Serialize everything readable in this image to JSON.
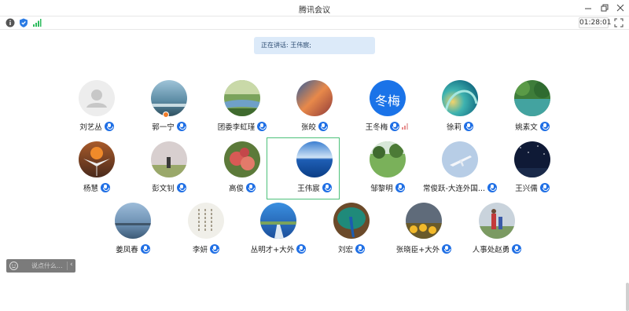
{
  "window": {
    "title": "腾讯会议"
  },
  "status": {
    "timer": "01:28:01"
  },
  "speaking": {
    "text": "正在讲话: 王伟宸;"
  },
  "participants": [
    {
      "name": "刘艺丛",
      "avatar": "default-avatar"
    },
    {
      "name": "郭一宁",
      "avatar": "photo-sea-shore"
    },
    {
      "name": "团委李虹瑾",
      "avatar": "photo-river-park"
    },
    {
      "name": "张皎",
      "avatar": "photo-sunset-clouds"
    },
    {
      "name": "王冬梅",
      "avatar": "text-avatar",
      "avatar_text": "冬梅"
    },
    {
      "name": "徐莉",
      "avatar": "photo-ocean-wave"
    },
    {
      "name": "姚素文",
      "avatar": "photo-green-lake"
    },
    {
      "name": "杨慧",
      "avatar": "photo-crane-sunset"
    },
    {
      "name": "彭文钊",
      "avatar": "photo-person-field"
    },
    {
      "name": "高俊",
      "avatar": "photo-apples"
    },
    {
      "name": "王伟宸",
      "avatar": "photo-blue-sea"
    },
    {
      "name": "邹黎明",
      "avatar": "photo-green-meadow"
    },
    {
      "name": "常俊跃-大连外国...",
      "avatar": "photo-airplane-sky"
    },
    {
      "name": "王兴儒",
      "avatar": "photo-night-sky"
    },
    {
      "name": "姜凤春",
      "avatar": "photo-lake-sky"
    },
    {
      "name": "李妍",
      "avatar": "photo-calligraphy"
    },
    {
      "name": "丛明才+大外",
      "avatar": "photo-road-sky"
    },
    {
      "name": "刘宏",
      "avatar": "photo-peacock"
    },
    {
      "name": "张晓臣+大外",
      "avatar": "photo-sunflowers"
    },
    {
      "name": "人事处赵勇",
      "avatar": "photo-family"
    }
  ],
  "chat": {
    "placeholder": "说点什么..."
  },
  "colors": {
    "accent": "#1f6fe5",
    "active_border": "#4cc17a",
    "banner": "#dceaf9"
  }
}
